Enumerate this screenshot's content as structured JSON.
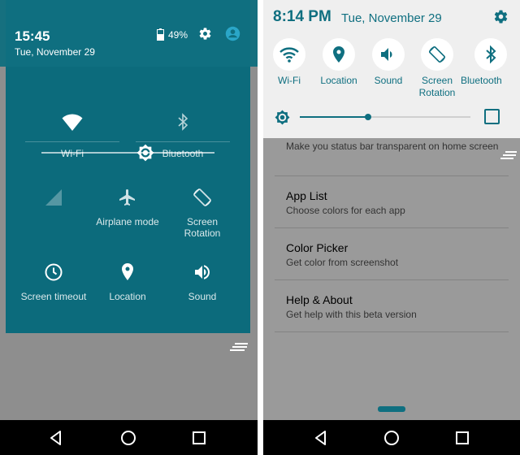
{
  "left": {
    "status": {
      "time": "15:45",
      "date": "Tue, November 29",
      "battery": "49%"
    },
    "tiles": [
      {
        "label": "Wi-Fi",
        "icon": "wifi-icon"
      },
      {
        "label": "Bluetooth",
        "icon": "bluetooth-icon"
      },
      {
        "label": "",
        "icon": "cell-signal-icon"
      },
      {
        "label": "Airplane mode",
        "icon": "airplane-icon"
      },
      {
        "label": "Screen Rotation",
        "icon": "rotation-icon"
      },
      {
        "label": "Screen timeout",
        "icon": "clock-icon"
      },
      {
        "label": "Location",
        "icon": "location-pin-icon"
      },
      {
        "label": "Sound",
        "icon": "speaker-icon"
      }
    ],
    "brightness_level": 0.6
  },
  "right": {
    "status": {
      "time": "8:14 PM",
      "date": "Tue, November 29"
    },
    "tiles": [
      {
        "label": "Wi-Fi",
        "icon": "wifi-icon"
      },
      {
        "label": "Location",
        "icon": "location-pin-icon"
      },
      {
        "label": "Sound",
        "icon": "speaker-icon"
      },
      {
        "label": "Screen",
        "label2": "Rotation",
        "icon": "rotation-icon"
      },
      {
        "label": "Bluetooth",
        "icon": "bluetooth-icon"
      }
    ],
    "brightness_level": 0.4,
    "partial_item": {
      "subtitle": "Make you status bar transparent on home screen"
    },
    "list": [
      {
        "title": "App List",
        "subtitle": "Choose colors for each app"
      },
      {
        "title": "Color Picker",
        "subtitle": "Get color from screenshot"
      },
      {
        "title": "Help & About",
        "subtitle": "Get help with this beta version"
      }
    ]
  },
  "colors": {
    "accent": "#0f6f80",
    "panel": "#0c6b7c",
    "navbar": "#000000",
    "overlay": "#9a9a9a"
  }
}
